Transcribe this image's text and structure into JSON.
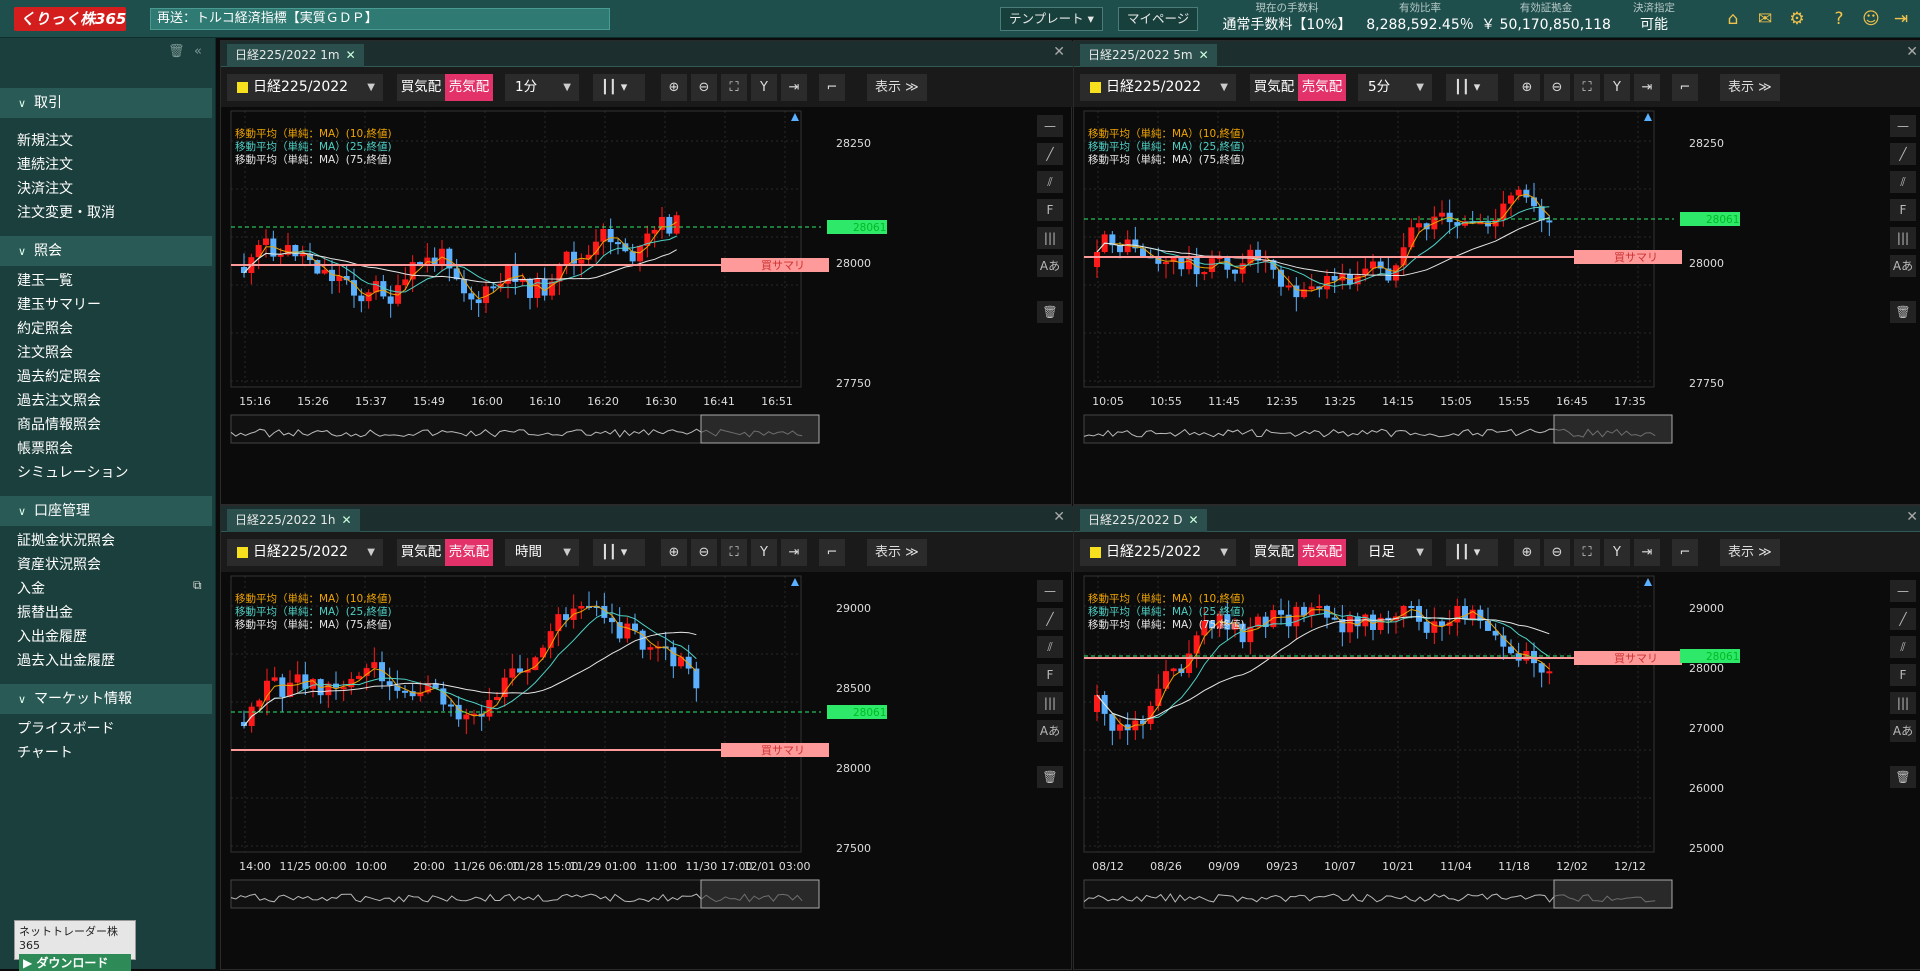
{
  "header": {
    "logo": "くりっく株365",
    "ticker": "再送：トルコ経済指標【実質ＧＤＰ】",
    "template_btn": "テンプレート",
    "mypage_btn": "マイページ",
    "stats": [
      {
        "label": "現在の手数料",
        "value": "通常手数料【10%】"
      },
      {
        "label": "有効比率",
        "value": "8,288,592.45％"
      },
      {
        "label": "有効証拠金",
        "value": "￥ 50,170,850,118"
      },
      {
        "label": "決済指定",
        "value": "可能"
      }
    ],
    "icons": [
      "home-icon",
      "mail-icon",
      "gear-icon",
      "help-icon",
      "user-icon",
      "logout-icon"
    ]
  },
  "sidebar": {
    "sections": [
      {
        "label": "取引",
        "items": [
          "新規注文",
          "連続注文",
          "決済注文",
          "注文変更・取消"
        ]
      },
      {
        "label": "照会",
        "items": [
          "建玉一覧",
          "建玉サマリー",
          "約定照会",
          "注文照会",
          "過去約定照会",
          "過去注文照会",
          "商品情報照会",
          "帳票照会",
          "シミュレーション"
        ]
      },
      {
        "label": "口座管理",
        "items": [
          "証拠金状況照会",
          "資産状況照会",
          "入金",
          "振替出金",
          "入出金履歴",
          "過去入出金履歴"
        ]
      },
      {
        "label": "マーケット情報",
        "items": [
          "プライスボード",
          "チャート"
        ]
      }
    ],
    "download_title": "ネットトレーダー株365",
    "download_btn": "ダウンロード"
  },
  "panels": [
    {
      "tab": "日経225/2022 1m",
      "symbol": "日経225/2022",
      "buy": "買気配",
      "sell": "売気配",
      "timeframe": "1分",
      "display": "表示",
      "legend": [
        "移動平均（単純：MA）(10,終値)",
        "移動平均（単純：MA）(25,終値)",
        "移動平均（単純：MA）(75,終値)"
      ],
      "price_labels": [
        "28250",
        "28000",
        "27750"
      ],
      "time_labels": [
        "15:16",
        "15:26",
        "15:37",
        "15:49",
        "16:00",
        "16:10",
        "16:20",
        "16:30",
        "16:41",
        "16:51"
      ],
      "current_price": "28061",
      "position_label": "買サマリ"
    },
    {
      "tab": "日経225/2022 5m",
      "symbol": "日経225/2022",
      "buy": "買気配",
      "sell": "売気配",
      "timeframe": "5分",
      "display": "表示",
      "legend": [
        "移動平均（単純：MA）(10,終値)",
        "移動平均（単純：MA）(25,終値)",
        "移動平均（単純：MA）(75,終値)"
      ],
      "price_labels": [
        "28250",
        "28000",
        "27750"
      ],
      "time_labels": [
        "10:05",
        "10:55",
        "11:45",
        "12:35",
        "13:25",
        "14:15",
        "15:05",
        "15:55",
        "16:45",
        "17:35"
      ],
      "current_price": "28061",
      "position_label": "買サマリ"
    },
    {
      "tab": "日経225/2022 1h",
      "symbol": "日経225/2022",
      "buy": "買気配",
      "sell": "売気配",
      "timeframe": "時間",
      "display": "表示",
      "legend": [
        "移動平均（単純：MA）(10,終値)",
        "移動平均（単純：MA）(25,終値)",
        "移動平均（単純：MA）(75,終値)"
      ],
      "price_labels": [
        "29000",
        "28500",
        "28000",
        "27500"
      ],
      "time_labels": [
        "14:00",
        "11/25 00:00",
        "10:00",
        "20:00",
        "11/26 06:00",
        "11/28 15:00",
        "11/29 01:00",
        "11:00",
        "11/30 17:00",
        "12/01 03:00"
      ],
      "current_price": "28061",
      "position_label": "買サマリ"
    },
    {
      "tab": "日経225/2022 D",
      "symbol": "日経225/2022",
      "buy": "買気配",
      "sell": "売気配",
      "timeframe": "日足",
      "display": "表示",
      "legend": [
        "移動平均（単純：MA）(10,終値)",
        "移動平均（単純：MA）(25,終値)",
        "移動平均（単純：MA）(75,終値)"
      ],
      "price_labels": [
        "29000",
        "28000",
        "27000",
        "26000",
        "25000"
      ],
      "time_labels": [
        "08/12",
        "08/26",
        "09/09",
        "09/23",
        "10/07",
        "10/21",
        "11/04",
        "11/18",
        "12/02",
        "12/12"
      ],
      "current_price": "28061",
      "position_label": "買サマリ"
    }
  ],
  "colors": {
    "up": "#ff1a1a",
    "down": "#5ab0ff",
    "ma10": "#f0a500",
    "ma25": "#4fd1c5",
    "ma75": "#e6e6e6",
    "price_tag": "#2ee86a",
    "pos_tag": "#ff9a9a",
    "sell": "#e3326a"
  }
}
